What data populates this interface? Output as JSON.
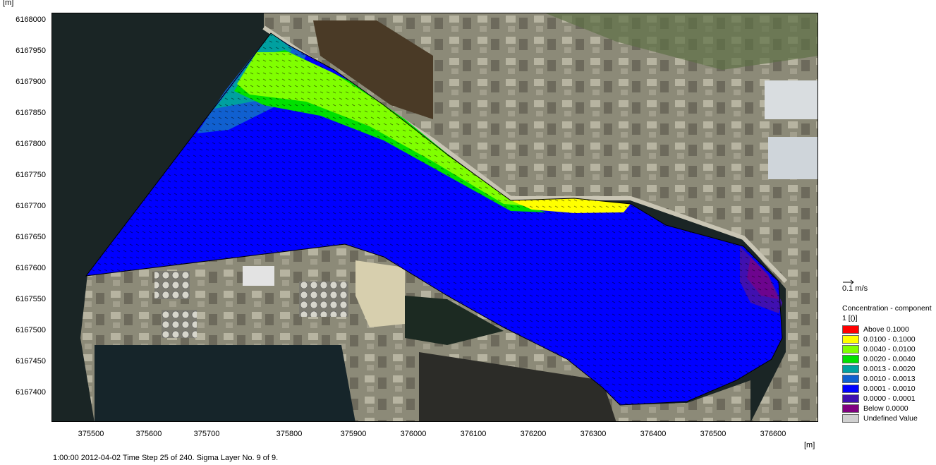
{
  "axes": {
    "y_unit": "[m]",
    "x_unit": "[m]",
    "y_ticks": [
      "6168000",
      "6167950",
      "6167900",
      "6167850",
      "6167800",
      "6167750",
      "6167700",
      "6167650",
      "6167600",
      "6167550",
      "6167500",
      "6167450",
      "6167400"
    ],
    "x_ticks": [
      "375500",
      "375600",
      "375700",
      "375800",
      "375900",
      "376000",
      "376100",
      "376200",
      "376300",
      "376400",
      "376500",
      "376600"
    ]
  },
  "status_bar": {
    "text": "1:00:00 2012-04-02  Time Step 25 of 240. Sigma Layer No. 9 of 9."
  },
  "legend": {
    "vector_scale_label": "0.1 m/s",
    "title_line1": "Concentration - component",
    "title_line2": "1 [()]",
    "items": [
      {
        "label": "Above   0.1000",
        "color": "#ff0000"
      },
      {
        "label": "0.0100 - 0.1000",
        "color": "#ffff00"
      },
      {
        "label": "0.0040 - 0.0100",
        "color": "#80ff00"
      },
      {
        "label": "0.0020 - 0.0040",
        "color": "#00e000"
      },
      {
        "label": "0.0013 - 0.0020",
        "color": "#00a0a0"
      },
      {
        "label": "0.0010 - 0.0013",
        "color": "#1060d0"
      },
      {
        "label": "0.0001 - 0.0010",
        "color": "#0000ff"
      },
      {
        "label": "0.0000 - 0.0001",
        "color": "#4010b0"
      },
      {
        "label": "Below    0.0000",
        "color": "#800080"
      },
      {
        "label": "Undefined Value",
        "color": "#d0d0d0"
      }
    ]
  }
}
